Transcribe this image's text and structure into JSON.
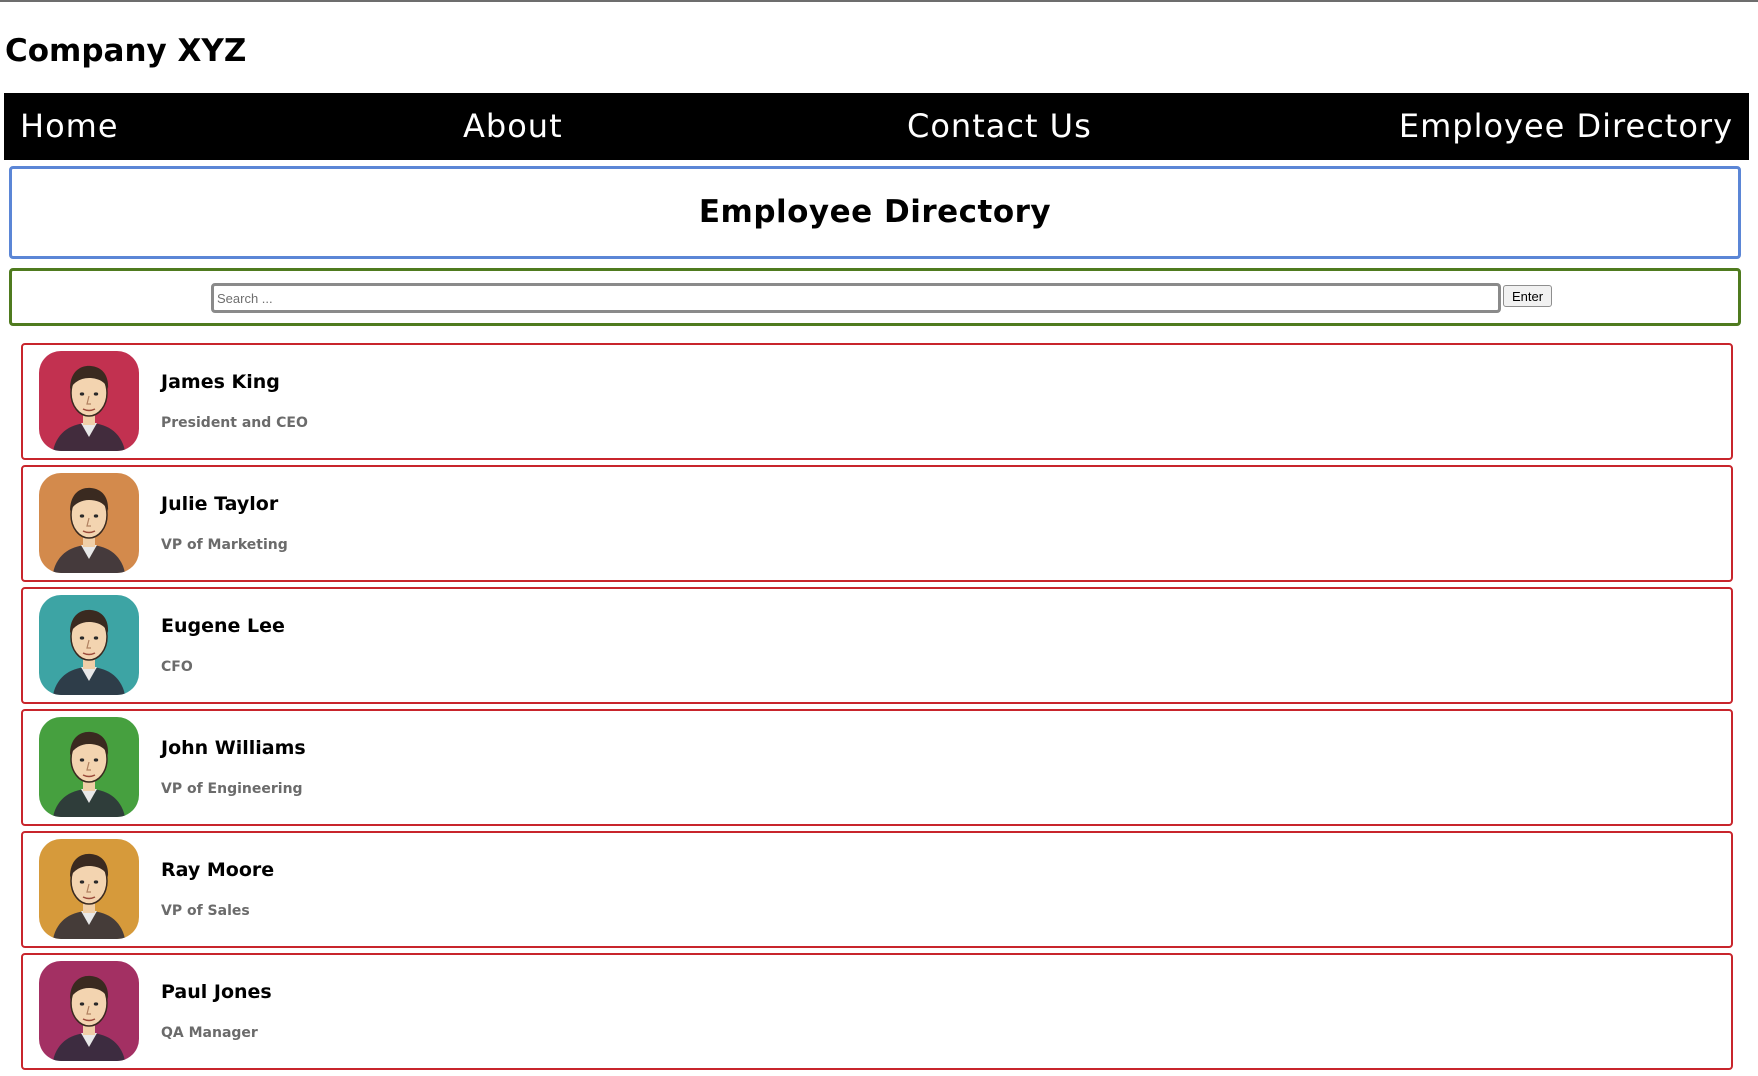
{
  "site": {
    "title": "Company XYZ"
  },
  "nav": {
    "home": "Home",
    "about": "About",
    "contact": "Contact Us",
    "directory": "Employee Directory"
  },
  "page": {
    "heading": "Employee Directory"
  },
  "search": {
    "placeholder": "Search ...",
    "value": "",
    "button_label": "Enter"
  },
  "colors": {
    "header_border": "#5b86d6",
    "search_border": "#4f7b1f",
    "card_border": "#c8252c",
    "nav_background": "#000000"
  },
  "employees": [
    {
      "name": "James King",
      "title": "President and CEO",
      "avatar_icon": "avatar-portrait-icon",
      "avatar_bg": "#c23150"
    },
    {
      "name": "Julie Taylor",
      "title": "VP of Marketing",
      "avatar_icon": "avatar-portrait-icon",
      "avatar_bg": "#d38a4c"
    },
    {
      "name": "Eugene Lee",
      "title": "CFO",
      "avatar_icon": "avatar-portrait-icon",
      "avatar_bg": "#3da4a4"
    },
    {
      "name": "John Williams",
      "title": "VP of Engineering",
      "avatar_icon": "avatar-portrait-icon",
      "avatar_bg": "#46a03f"
    },
    {
      "name": "Ray Moore",
      "title": "VP of Sales",
      "avatar_icon": "avatar-portrait-icon",
      "avatar_bg": "#d69a3b"
    },
    {
      "name": "Paul Jones",
      "title": "QA Manager",
      "avatar_icon": "avatar-portrait-icon",
      "avatar_bg": "#a33063"
    }
  ]
}
